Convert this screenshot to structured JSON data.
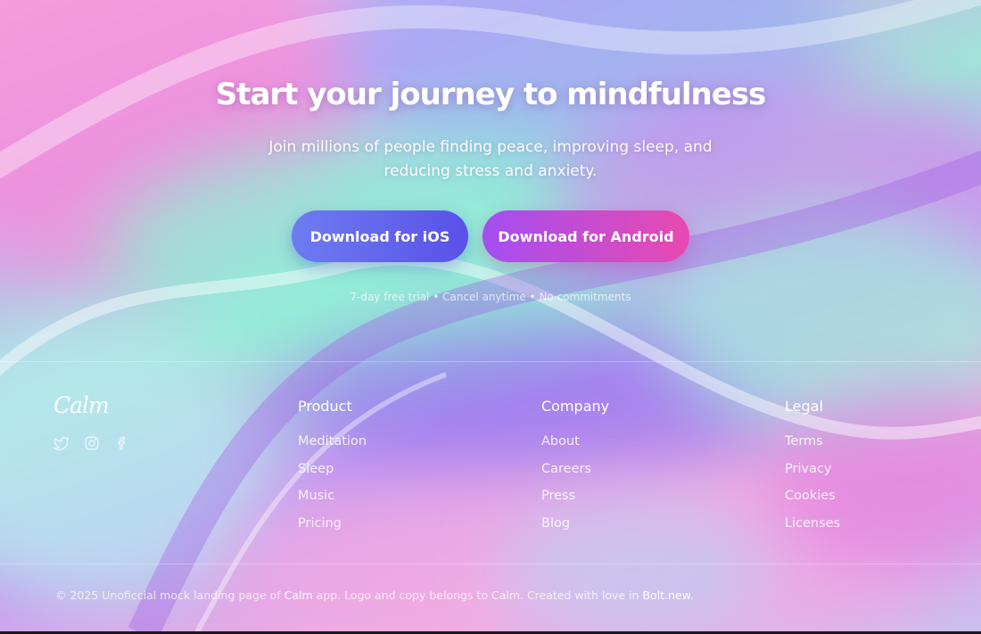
{
  "hero": {
    "title": "Start your journey to mindfulness",
    "subtitle": "Join millions of people finding peace, improving sleep, and reducing stress and anxiety.",
    "ios_label": "Download for iOS",
    "android_label": "Download for Android",
    "trial_note": "7-day free trial • Cancel anytime • No commitments"
  },
  "footer": {
    "logo": "Calm",
    "social_icons": [
      "twitter-icon",
      "instagram-icon",
      "facebook-icon"
    ],
    "columns": [
      {
        "title": "Product",
        "links": [
          "Meditation",
          "Sleep",
          "Music",
          "Pricing"
        ]
      },
      {
        "title": "Company",
        "links": [
          "About",
          "Careers",
          "Press",
          "Blog"
        ]
      },
      {
        "title": "Legal",
        "links": [
          "Terms",
          "Privacy",
          "Cookies",
          "Licenses"
        ]
      }
    ],
    "copyright": {
      "prefix": "© 2025 Unoficcial mock landing page of ",
      "brand": "Calm",
      "middle": " app. Logo and copy belongs to Calm. Created with love in ",
      "builder": "Bolt.new",
      "suffix": "."
    }
  },
  "colors": {
    "ios_button": "#5a50e8",
    "android_button_start": "#a44ef0",
    "android_button_end": "#e84ab0"
  }
}
